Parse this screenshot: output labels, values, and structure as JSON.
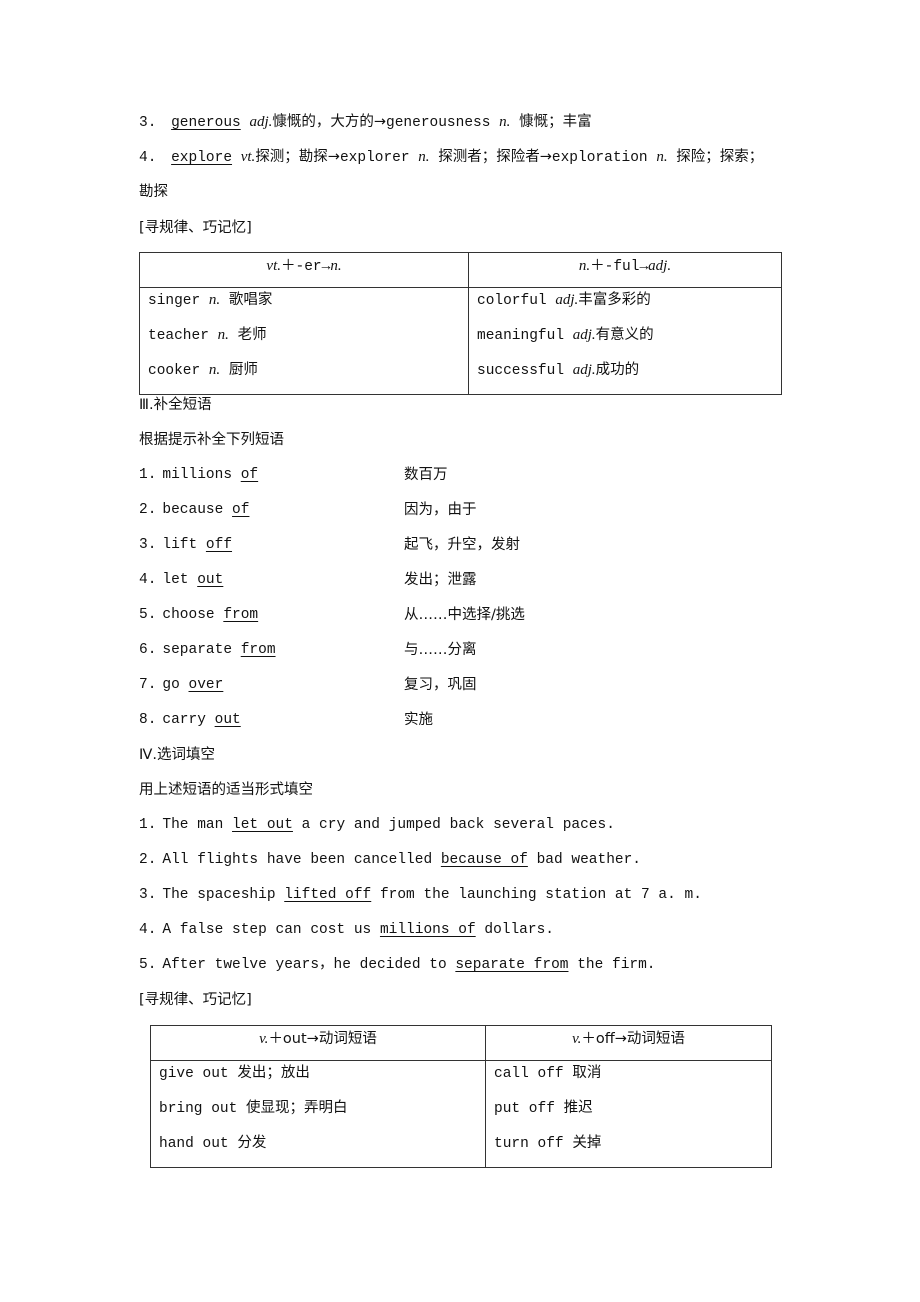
{
  "vocab_items": [
    {
      "number": "3.",
      "word": "generous",
      "pos": "adj.",
      "meaning": "慷慨的，大方的→",
      "derived_word": "generousness",
      "derived_pos": "n.",
      "derived_meaning": "慷慨；丰富"
    },
    {
      "number": "4.",
      "word": "explore",
      "pos": "vt.",
      "meaning": "探测；勘探→",
      "derived_word": "explorer",
      "derived_pos": "n.",
      "derived_meaning": "探测者；探险者→",
      "derived_word2": "exploration",
      "derived_pos2": "n.",
      "derived_meaning2": "探险；探索；",
      "continuation": "勘探"
    }
  ],
  "memo_label_1": "[寻规律、巧记忆]",
  "table1": {
    "headers": [
      {
        "pre": "vt.",
        "mid": "＋-er→",
        "post": "n."
      },
      {
        "pre": "n.",
        "mid": "＋-ful→",
        "post": "adj."
      }
    ],
    "rows": [
      [
        {
          "word": "singer",
          "pos": "n.",
          "meaning": "歌唱家"
        },
        {
          "word": "colorful",
          "pos": "adj.",
          "meaning": "丰富多彩的"
        }
      ],
      [
        {
          "word": "teacher",
          "pos": "n.",
          "meaning": "老师"
        },
        {
          "word": "meaningful",
          "pos": "adj.",
          "meaning": "有意义的"
        }
      ],
      [
        {
          "word": "cooker",
          "pos": "n.",
          "meaning": "厨师"
        },
        {
          "word": "successful",
          "pos": "adj.",
          "meaning": "成功的"
        }
      ]
    ]
  },
  "section3": {
    "title": "Ⅲ.补全短语",
    "instruction": "根据提示补全下列短语",
    "phrases": [
      {
        "number": "1.",
        "stem": "millions",
        "answer": "of",
        "meaning": "数百万"
      },
      {
        "number": "2.",
        "stem": "because",
        "answer": "of",
        "meaning": "因为，由于"
      },
      {
        "number": "3.",
        "stem": "lift",
        "answer": "off",
        "meaning": "起飞，升空，发射"
      },
      {
        "number": "4.",
        "stem": "let",
        "answer": "out",
        "meaning": "发出；泄露"
      },
      {
        "number": "5.",
        "stem": "choose",
        "answer": "from",
        "meaning": "从……中选择/挑选"
      },
      {
        "number": "6.",
        "stem": "separate",
        "answer": "from",
        "meaning": "与……分离"
      },
      {
        "number": "7.",
        "stem": "go",
        "answer": "over",
        "meaning": "复习，巩固"
      },
      {
        "number": "8.",
        "stem": "carry",
        "answer": "out",
        "meaning": "实施"
      }
    ]
  },
  "section4": {
    "title": "Ⅳ.选词填空",
    "instruction": "用上述短语的适当形式填空",
    "sentences": [
      {
        "number": "1.",
        "before": "The man",
        "answer": "let out",
        "after": "a cry and jumped back several paces."
      },
      {
        "number": "2.",
        "before": "All flights have been cancelled",
        "answer": "because of",
        "after": "bad weather."
      },
      {
        "number": "3.",
        "before": "The spaceship",
        "answer": "lifted off",
        "after": "from the launching station at 7 a. m."
      },
      {
        "number": "4.",
        "before": "A false step can cost us",
        "answer": "millions of",
        "after": "dollars."
      },
      {
        "number": "5.",
        "before": "After twelve years，he decided to",
        "answer": "separate from",
        "after": "the firm."
      }
    ]
  },
  "memo_label_2": "[寻规律、巧记忆]",
  "table2": {
    "headers": [
      {
        "pre": "v.",
        "mid": "＋out→动词短语"
      },
      {
        "pre": "v.",
        "mid": "＋off→动词短语"
      }
    ],
    "rows": [
      [
        {
          "word": "give out",
          "meaning": "发出；放出"
        },
        {
          "word": "call off",
          "meaning": "取消"
        }
      ],
      [
        {
          "word": "bring out",
          "meaning": "使显现；弄明白"
        },
        {
          "word": "put off",
          "meaning": "推迟"
        }
      ],
      [
        {
          "word": "hand out",
          "meaning": "分发"
        },
        {
          "word": "turn off",
          "meaning": "关掉"
        }
      ]
    ]
  }
}
